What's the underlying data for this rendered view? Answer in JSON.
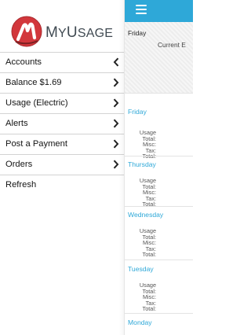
{
  "app": {
    "name_prefix": "M",
    "name_rest_a": "Y",
    "name_space": "U",
    "name_rest_b": "SAGE"
  },
  "menu": {
    "items": [
      {
        "label": "Accounts"
      },
      {
        "label": "Balance $1.69"
      },
      {
        "label": "Usage (Electric)"
      },
      {
        "label": "Alerts"
      },
      {
        "label": "Post a Payment"
      },
      {
        "label": "Orders"
      },
      {
        "label": "Refresh"
      }
    ]
  },
  "content": {
    "header_day": "Friday",
    "header_current": "Current E",
    "days": [
      {
        "name": "Friday",
        "lines": [
          "Usage Total:",
          "Misc:",
          "Tax:",
          "Total:"
        ]
      },
      {
        "name": "Thursday",
        "lines": [
          "Usage Total:",
          "Misc:",
          "Tax:",
          "Total:"
        ]
      },
      {
        "name": "Wednesday",
        "lines": [
          "Usage Total:",
          "Misc:",
          "Tax:",
          "Total:"
        ]
      },
      {
        "name": "Tuesday",
        "lines": [
          "Usage Total:",
          "Misc:",
          "Tax:",
          "Total:"
        ]
      },
      {
        "name": "Monday"
      }
    ]
  },
  "colors": {
    "accent": "#2ea8d8",
    "logo_red": "#d2373c",
    "logo_dark": "#7a2021"
  },
  "icons": {
    "menu": "hamburger-icon",
    "chevron": "chevron-right-icon",
    "logo": "logo-icon"
  }
}
